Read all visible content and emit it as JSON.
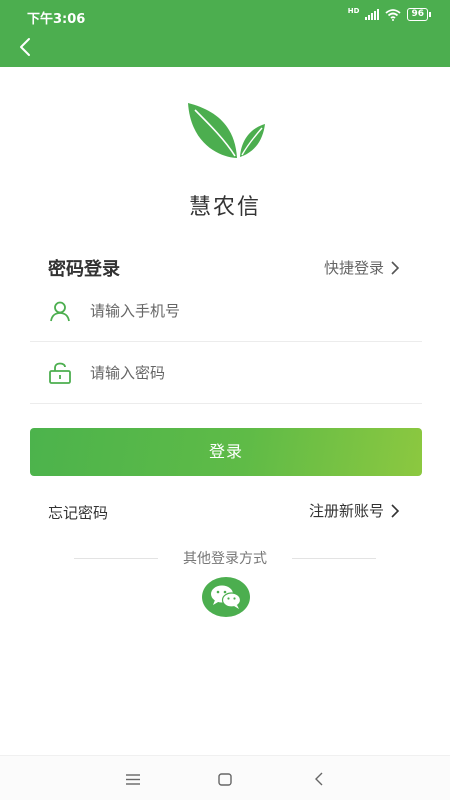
{
  "status_bar": {
    "time": "下午3:06",
    "network": "HD",
    "battery": "96"
  },
  "header": {
    "back_icon": "chevron-left-icon",
    "color": "#4cae4f"
  },
  "app": {
    "name": "慧农信",
    "logo_icon": "leaf-logo-icon"
  },
  "login": {
    "title": "密码登录",
    "quick_login_label": "快捷登录",
    "phone_placeholder": "请输入手机号",
    "password_placeholder": "请输入密码",
    "submit_label": "登录",
    "forgot_label": "忘记密码",
    "register_label": "注册新账号",
    "accent_color": "#4cae4f"
  },
  "other_login": {
    "label": "其他登录方式",
    "wechat_icon": "wechat-icon"
  },
  "nav_bar": {
    "menu_icon": "menu-icon",
    "home_icon": "home-square-icon",
    "back_icon": "back-triangle-icon"
  }
}
